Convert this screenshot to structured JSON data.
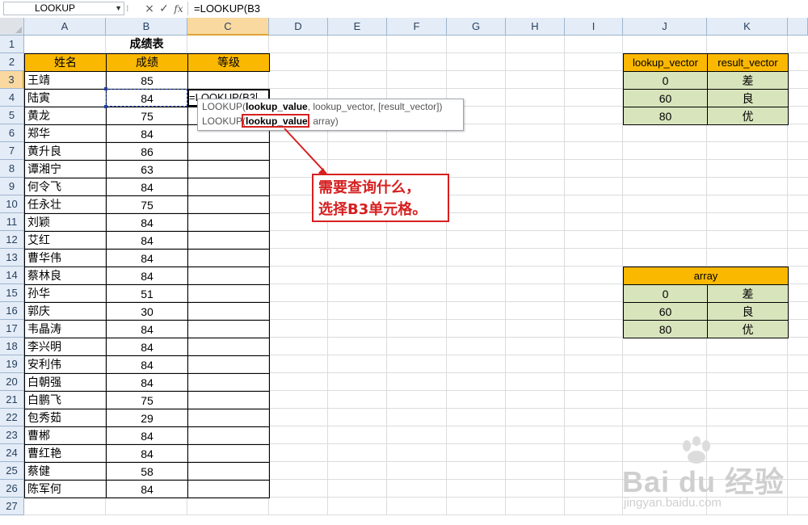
{
  "formula_bar": {
    "name_box": "LOOKUP",
    "cancel_icon": "×",
    "enter_icon": "✓",
    "fx_label": "fx",
    "formula": "=LOOKUP(B3"
  },
  "columns": [
    "A",
    "B",
    "C",
    "D",
    "E",
    "F",
    "G",
    "H",
    "I",
    "J",
    "K"
  ],
  "active_column": "C",
  "active_row": 3,
  "rows": [
    "1",
    "2",
    "3",
    "4",
    "5",
    "6",
    "7",
    "8",
    "9",
    "10",
    "11",
    "12",
    "13",
    "14",
    "15",
    "16",
    "17",
    "18",
    "19",
    "20",
    "21",
    "22",
    "23",
    "24",
    "25",
    "26",
    "27"
  ],
  "title": "成绩表",
  "table": {
    "headers": [
      "姓名",
      "成绩",
      "等级"
    ],
    "rows": [
      [
        "王靖",
        "85"
      ],
      [
        "陆寅",
        "84"
      ],
      [
        "黄龙",
        "75"
      ],
      [
        "郑华",
        "84"
      ],
      [
        "黄升良",
        "86"
      ],
      [
        "谭湘宁",
        "63"
      ],
      [
        "何令飞",
        "84"
      ],
      [
        "任永壮",
        "75"
      ],
      [
        "刘颖",
        "84"
      ],
      [
        "艾红",
        "84"
      ],
      [
        "曹华伟",
        "84"
      ],
      [
        "蔡林良",
        "84"
      ],
      [
        "孙华",
        "51"
      ],
      [
        "郭庆",
        "30"
      ],
      [
        "韦晶涛",
        "84"
      ],
      [
        "李兴明",
        "84"
      ],
      [
        "安利伟",
        "84"
      ],
      [
        "白朝强",
        "84"
      ],
      [
        "白鹏飞",
        "75"
      ],
      [
        "包秀茹",
        "29"
      ],
      [
        "曹郴",
        "84"
      ],
      [
        "曹红艳",
        "84"
      ],
      [
        "蔡健",
        "58"
      ],
      [
        "陈军何",
        "84"
      ]
    ]
  },
  "editing_cell": "=LOOKUP(B3",
  "tooltip": {
    "line1_fn": "LOOKUP(",
    "line1_bold": "lookup_value",
    "line1_rest": ", lookup_vector, [result_vector])",
    "line2_fn": "LOOKUP(",
    "line2_bold": "lookup_value",
    "line2_rest": ", array)"
  },
  "vector_table": {
    "headers": [
      "lookup_vector",
      "result_vector"
    ],
    "rows": [
      [
        "0",
        "差"
      ],
      [
        "60",
        "良"
      ],
      [
        "80",
        "优"
      ]
    ]
  },
  "array_table": {
    "header": "array",
    "rows": [
      [
        "0",
        "差"
      ],
      [
        "60",
        "良"
      ],
      [
        "80",
        "优"
      ]
    ]
  },
  "callout": {
    "line1": "需要查询什么，",
    "line2": "选择B3单元格。"
  },
  "watermark": {
    "logo": "Bai du 经验",
    "url": "jingyan.baidu.com"
  },
  "colors": {
    "header_orange": "#fbb800",
    "green_fill": "#d8e4bc",
    "annotation_red": "#d62020",
    "grid_line": "#dadcdd"
  }
}
